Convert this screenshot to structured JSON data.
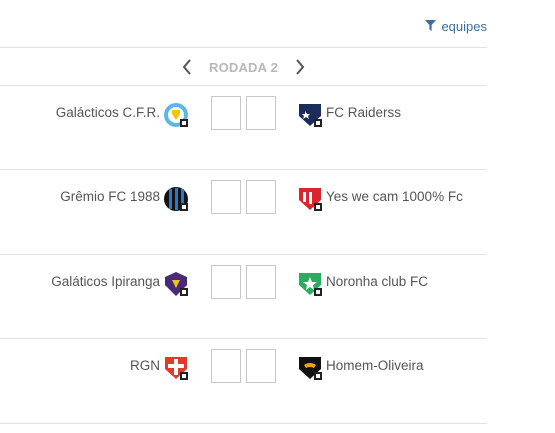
{
  "filter": {
    "label": "equipes",
    "icon": "filter-icon"
  },
  "round": {
    "label": "RODADA 2"
  },
  "matches": [
    {
      "home": {
        "name": "Galácticos C.F.R.",
        "crest": "galacticos-cfr-crest-icon"
      },
      "away": {
        "name": "FC Raiderss",
        "crest": "fc-raiderss-crest-icon"
      },
      "home_score": "",
      "away_score": ""
    },
    {
      "home": {
        "name": "Grêmio FC 1988",
        "crest": "gremio-fc-1988-crest-icon"
      },
      "away": {
        "name": "Yes we cam 1000% Fc",
        "crest": "yes-we-cam-crest-icon"
      },
      "home_score": "",
      "away_score": ""
    },
    {
      "home": {
        "name": "Galáticos Ipiranga",
        "crest": "galaticos-ipiranga-crest-icon"
      },
      "away": {
        "name": "Noronha club FC",
        "crest": "noronha-club-crest-icon"
      },
      "home_score": "",
      "away_score": ""
    },
    {
      "home": {
        "name": "RGN",
        "crest": "rgn-crest-icon"
      },
      "away": {
        "name": "Homem-Oliveira",
        "crest": "homem-oliveira-crest-icon"
      },
      "home_score": "",
      "away_score": ""
    }
  ]
}
